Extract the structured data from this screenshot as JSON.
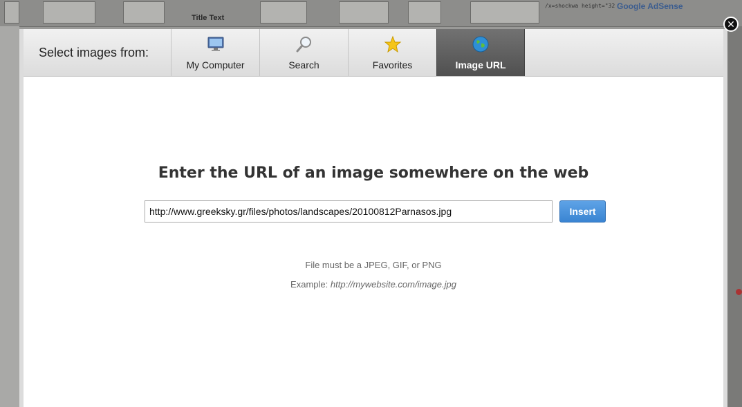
{
  "background": {
    "title_text": "Title Text",
    "code_snippet": "/x=shockwa height=\"32",
    "ad_text": "Google AdSense"
  },
  "dialog": {
    "select_label": "Select images from:",
    "tabs": [
      {
        "label": "My Computer",
        "icon": "monitor-icon"
      },
      {
        "label": "Search",
        "icon": "magnifier-icon"
      },
      {
        "label": "Favorites",
        "icon": "star-icon"
      },
      {
        "label": "Image URL",
        "icon": "globe-icon",
        "active": true
      }
    ],
    "close_symbol": "✕"
  },
  "main": {
    "heading": "Enter the URL of an image somewhere on the web",
    "url_value": "http://www.greeksky.gr/files/photos/landscapes/20100812Parnasos.jpg",
    "insert_label": "Insert",
    "hint_formats": "File must be a JPEG, GIF, or PNG",
    "hint_example_prefix": "Example:",
    "hint_example_url": "http://mywebsite.com/image.jpg"
  },
  "colors": {
    "active_tab": "#5f5f5f",
    "insert_button": "#4a94dc"
  }
}
